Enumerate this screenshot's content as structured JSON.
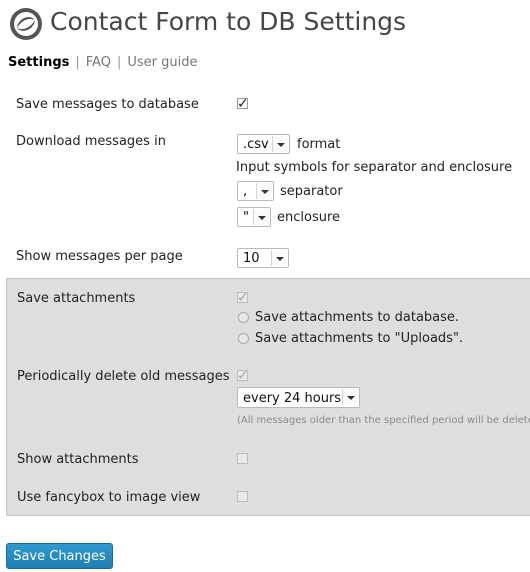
{
  "header": {
    "title": "Contact Form to DB Settings",
    "logo_icon": "gear-logo-icon"
  },
  "nav": {
    "settings": "Settings",
    "faq": "FAQ",
    "user_guide": "User guide",
    "separator": "|"
  },
  "settings": {
    "save_messages": {
      "label": "Save messages to database",
      "checked": true
    },
    "download": {
      "label": "Download messages in",
      "format_value": ".csv",
      "format_suffix": "format",
      "hint": "Input symbols for separator and enclosure",
      "separator_value": ",",
      "separator_label": "separator",
      "enclosure_value": "\"",
      "enclosure_label": "enclosure"
    },
    "per_page": {
      "label": "Show messages per page",
      "value": "10"
    }
  },
  "pro_panel": {
    "save_attachments": {
      "label": "Save attachments",
      "checked": true,
      "options": [
        "Save attachments to database.",
        "Save attachments to \"Uploads\"."
      ]
    },
    "delete_old": {
      "label": "Periodically delete old messages",
      "checked": true,
      "interval": "every 24 hours",
      "note": "(All messages older than the specified period will be deleted"
    },
    "show_attachments": {
      "label": "Show attachments",
      "checked": false
    },
    "fancybox": {
      "label": "Use fancybox to image view",
      "checked": false
    }
  },
  "footer": {
    "save_button": "Save Changes"
  },
  "colors": {
    "button": "#2388c0",
    "panel_bg": "#dedede",
    "title": "#464646"
  }
}
